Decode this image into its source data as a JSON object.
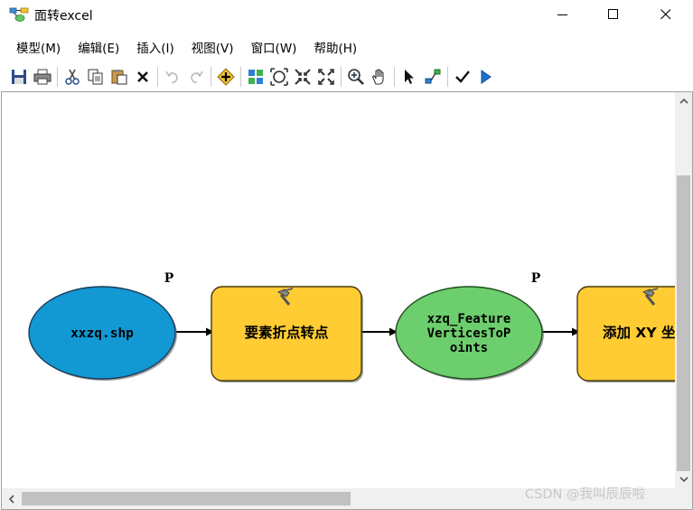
{
  "window": {
    "title": "面转excel",
    "icon": "model-builder-icon",
    "controls": [
      "minimize-icon",
      "maximize-icon",
      "close-icon"
    ]
  },
  "menu": [
    {
      "label": "模型(M)"
    },
    {
      "label": "编辑(E)"
    },
    {
      "label": "插入(I)"
    },
    {
      "label": "视图(V)"
    },
    {
      "label": "窗口(W)"
    },
    {
      "label": "帮助(H)"
    }
  ],
  "toolbar": {
    "buttons": [
      "save-icon",
      "print-icon",
      "cut-icon",
      "copy-icon",
      "paste-icon",
      "delete-icon",
      "undo-icon",
      "redo-icon",
      "add-data-icon",
      "auto-layout-icon",
      "full-extent-icon",
      "fixed-zoom-in-icon",
      "fixed-zoom-out-icon",
      "zoom-in-icon",
      "pan-icon",
      "select-icon",
      "connect-icon",
      "validate-icon",
      "run-icon"
    ]
  },
  "model": {
    "nodes": [
      {
        "label": "xxzq.shp",
        "kind": "data",
        "color": "#1298d3"
      },
      {
        "label": "要素折点转点",
        "kind": "tool",
        "color": "#ffcc33"
      },
      {
        "label_lines": [
          "xzq_Feature",
          "VerticesToP",
          "oints"
        ],
        "kind": "derived-data",
        "color": "#6cce6c",
        "badge": "P"
      },
      {
        "label": "添加 XY 坐",
        "kind": "tool",
        "color": "#ffcc33"
      }
    ],
    "first_param_badge": "P"
  },
  "watermark": "CSDN @我叫辰辰啦"
}
